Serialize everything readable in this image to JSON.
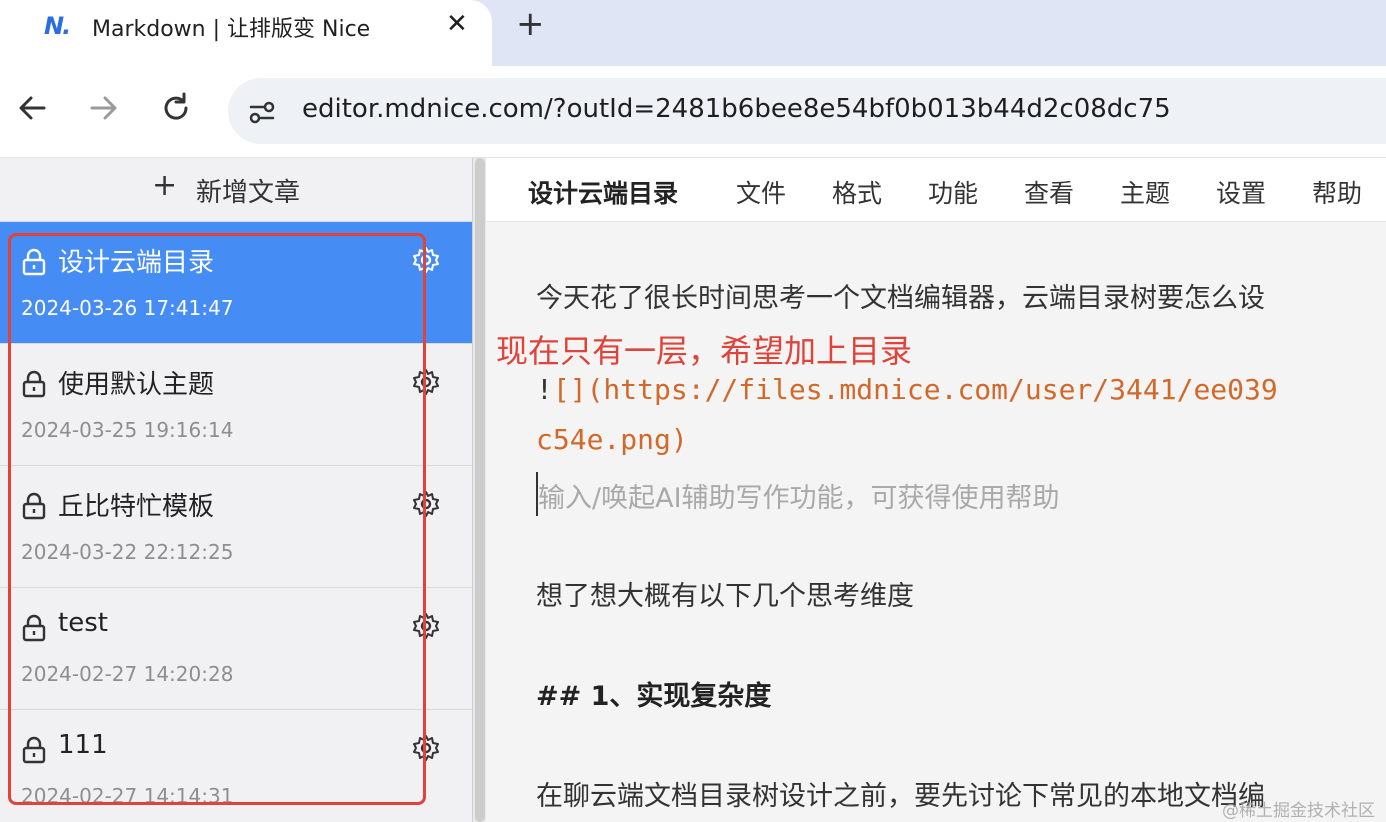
{
  "browser": {
    "tab_title": "Markdown | 让排版变 Nice",
    "favicon_text": "N.",
    "close_symbol": "✕",
    "new_tab_symbol": "+",
    "url": "editor.mdnice.com/?outId=2481b6bee8e54bf0b013b44d2c08dc75"
  },
  "sidebar": {
    "new_article_plus": "+",
    "new_article_label": "新增文章",
    "articles": [
      {
        "title": "设计云端目录",
        "date": "2024-03-26 17:41:47",
        "active": true
      },
      {
        "title": "使用默认主题",
        "date": "2024-03-25 19:16:14",
        "active": false
      },
      {
        "title": "丘比特忙模板",
        "date": "2024-03-22 22:12:25",
        "active": false
      },
      {
        "title": "test",
        "date": "2024-02-27 14:20:28",
        "active": false
      },
      {
        "title": "111",
        "date": "2024-02-27 14:14:31",
        "active": false
      }
    ]
  },
  "menubar": {
    "title": "设计云端目录",
    "items": [
      "文件",
      "格式",
      "功能",
      "查看",
      "主题",
      "设置",
      "帮助"
    ]
  },
  "content": {
    "p1": "今天花了很长时间思考一个文档编辑器，云端目录树要怎么设",
    "annotation": "现在只有一层，希望加上目录",
    "img_bang": "!",
    "img_line1": "[](https://files.mdnice.com/user/3441/ee039",
    "img_line2": "c54e.png)",
    "placeholder": "输入/唤起AI辅助写作功能，可获得使用帮助",
    "p2": "想了想大概有以下几个思考维度",
    "h2": "## 1、实现复杂度",
    "p3": "在聊云端文档目录树设计之前，要先讨论下常见的本地文档编",
    "watermark": "@稀土掘金技术社区"
  },
  "colors": {
    "active_item": "#458cf5",
    "annotation_red": "#e0433a",
    "code_orange": "#d2692a"
  }
}
